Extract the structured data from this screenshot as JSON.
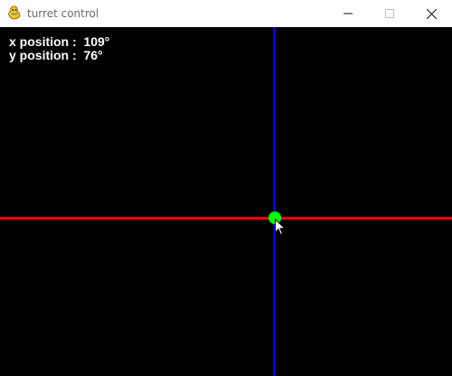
{
  "window": {
    "title": "turret control",
    "icon": "pygame-snake-icon",
    "controls": [
      "minimize-icon",
      "maximize-icon",
      "close-icon"
    ]
  },
  "readout": {
    "x_label": "x position :",
    "x_value": "109°",
    "y_label": "y position :",
    "y_value": "76°"
  },
  "colors": {
    "canvas_background": "#000000",
    "vertical_line": "#0000ff",
    "horizontal_line": "#ff0000",
    "target_dot": "#00ff00",
    "text": "#ffffff"
  }
}
